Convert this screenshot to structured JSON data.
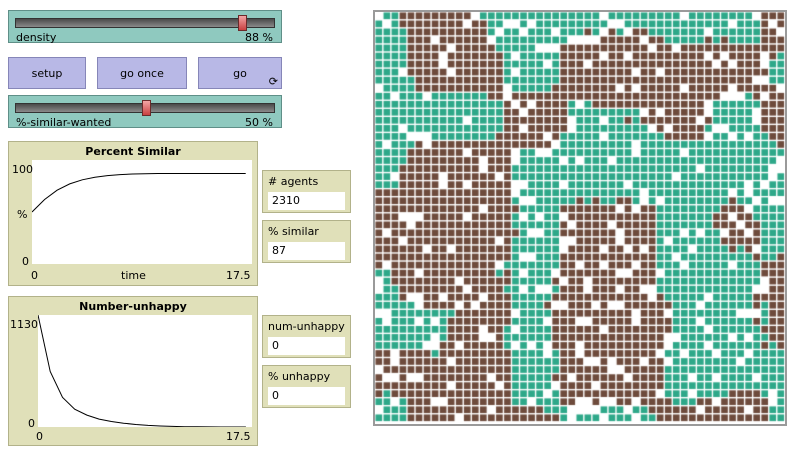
{
  "density_slider": {
    "label": "density",
    "value": "88 %",
    "fraction": 0.88
  },
  "buttons": {
    "setup": "setup",
    "go_once": "go once",
    "go": "go",
    "forever_glyph": "⟳"
  },
  "similar_slider": {
    "label": "%-similar-wanted",
    "value": "50 %",
    "fraction": 0.5
  },
  "plot_similar": {
    "title": "Percent Similar",
    "ymax": "100",
    "ymin": "0",
    "xmin": "0",
    "xmax": "17.5",
    "ylabel": "%",
    "xlabel": "time"
  },
  "plot_unhappy": {
    "title": "Number-unhappy",
    "ymax": "1130",
    "ymin": "0",
    "xmin": "0",
    "xmax": "17.5"
  },
  "monitors": {
    "agents": {
      "label": "# agents",
      "value": "2310"
    },
    "similar": {
      "label": "% similar",
      "value": "87"
    },
    "num_unhappy": {
      "label": "num-unhappy",
      "value": "0"
    },
    "pct_unhappy": {
      "label": "% unhappy",
      "value": "0"
    }
  },
  "colors": {
    "teal": "#2ea889",
    "brown": "#6e4b3c",
    "world_bg": "#ffffff",
    "widget_green": "#8fc9bf",
    "button_purple": "#b8b8e6",
    "plot_bg": "#e0e0b9"
  },
  "chart_data": [
    {
      "type": "line",
      "title": "Percent Similar",
      "xlabel": "time",
      "ylabel": "%",
      "xlim": [
        0,
        17.5
      ],
      "ylim": [
        0,
        100
      ],
      "series": [
        {
          "x": [
            0,
            1,
            2,
            3,
            4,
            5,
            6,
            7,
            8,
            9,
            10,
            11,
            12,
            13,
            14,
            15,
            16,
            17
          ],
          "values": [
            50,
            62,
            71,
            77,
            81,
            83.5,
            85,
            86,
            86.5,
            86.8,
            87,
            87,
            87,
            87,
            87,
            87,
            87,
            87
          ]
        }
      ]
    },
    {
      "type": "line",
      "title": "Number-unhappy",
      "xlabel": "",
      "ylabel": "",
      "xlim": [
        0,
        17.5
      ],
      "ylim": [
        0,
        1130
      ],
      "series": [
        {
          "x": [
            0,
            1,
            2,
            3,
            4,
            5,
            6,
            7,
            8,
            9,
            10,
            11,
            12,
            13,
            14,
            15,
            16,
            17
          ],
          "values": [
            1130,
            560,
            300,
            180,
            120,
            80,
            55,
            38,
            25,
            16,
            10,
            6,
            3,
            2,
            1,
            0,
            0,
            0
          ]
        }
      ]
    }
  ]
}
